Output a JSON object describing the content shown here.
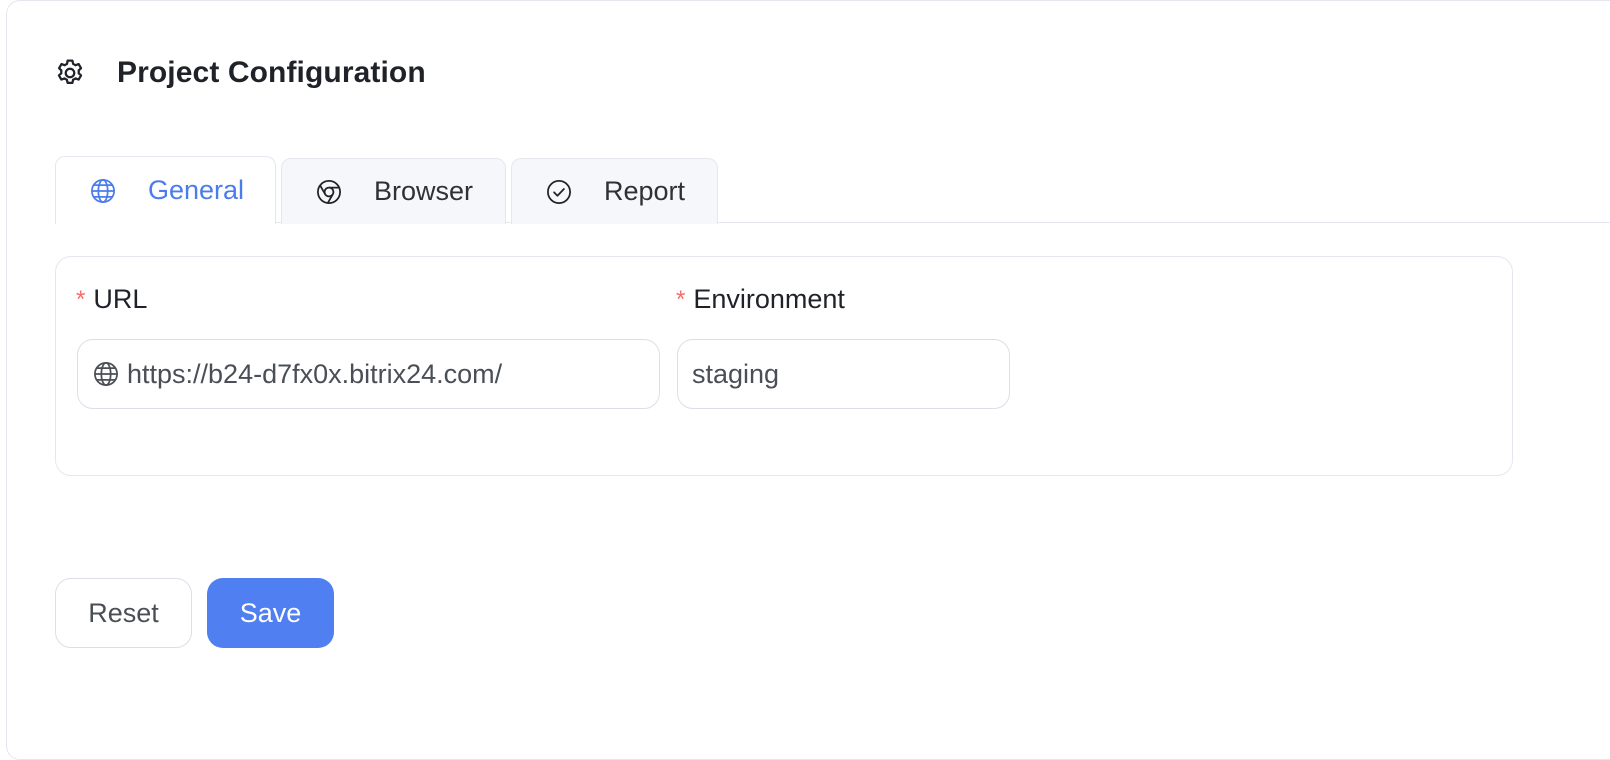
{
  "header": {
    "title": "Project Configuration",
    "icon": "gear-icon"
  },
  "tabs": [
    {
      "label": "General",
      "icon": "globe-icon",
      "active": true
    },
    {
      "label": "Browser",
      "icon": "chrome-icon",
      "active": false
    },
    {
      "label": "Report",
      "icon": "check-circle-icon",
      "active": false
    }
  ],
  "form": {
    "url": {
      "label": "URL",
      "required_mark": "*",
      "value": "https://b24-d7fx0x.bitrix24.com/",
      "prefix_icon": "globe-icon"
    },
    "environment": {
      "label": "Environment",
      "required_mark": "*",
      "value": "staging"
    }
  },
  "actions": {
    "reset_label": "Reset",
    "save_label": "Save"
  },
  "colors": {
    "accent": "#4b7bec",
    "primary_button": "#4f7ff0",
    "required": "#f56c6c",
    "border": "#e4e7ed",
    "tab_inactive_bg": "#f5f7fa"
  }
}
